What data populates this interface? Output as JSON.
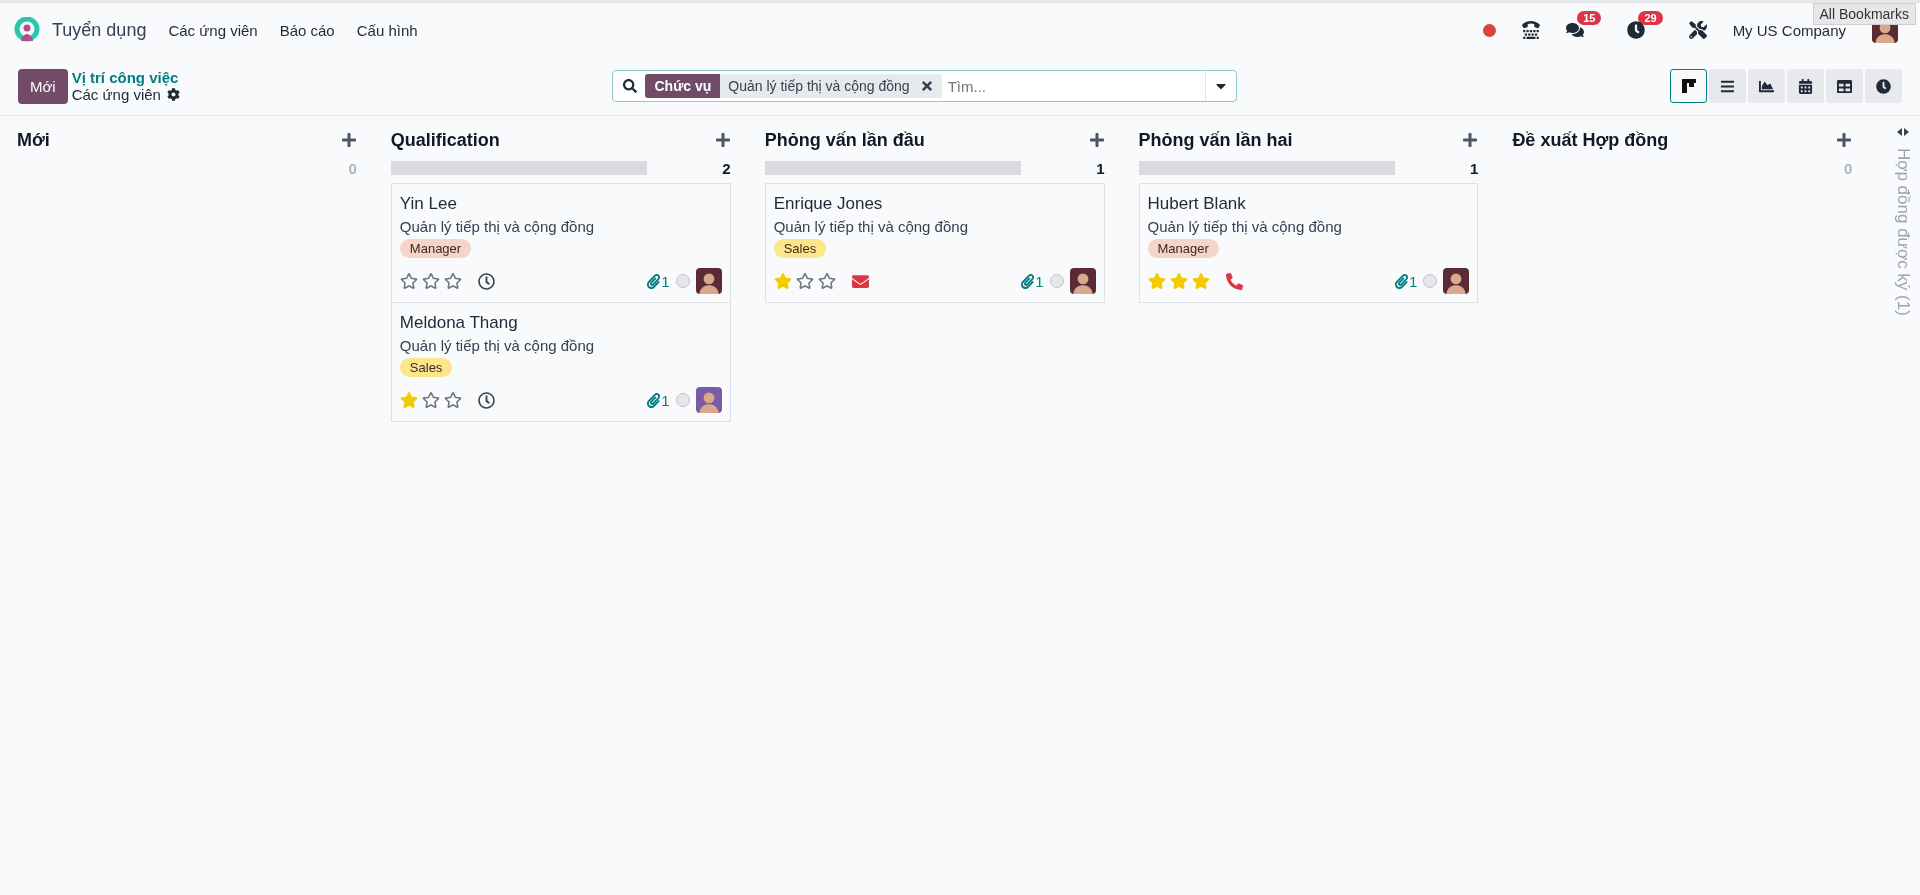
{
  "navbar": {
    "app_name": "Tuyển dụng",
    "menu": [
      "Các ứng viên",
      "Báo cáo",
      "Cấu hình"
    ],
    "systray": [
      {
        "kind": "recording"
      },
      {
        "kind": "phone"
      },
      {
        "kind": "messages",
        "badge": "15"
      },
      {
        "kind": "activities",
        "badge": "29"
      },
      {
        "kind": "tools"
      }
    ],
    "company": "My US Company",
    "tooltip": "All Bookmarks"
  },
  "control_panel": {
    "new_button": "Mới",
    "breadcrumb": "Vị trí công việc",
    "current": "Các ứng viên",
    "search": {
      "facet_label": "Chức vụ",
      "facet_value": "Quản lý tiếp thị và cộng đồng",
      "placeholder": "Tìm..."
    },
    "views": [
      {
        "kind": "kanban",
        "selected": true
      },
      {
        "kind": "list",
        "selected": false
      },
      {
        "kind": "graph",
        "selected": false
      },
      {
        "kind": "calendar",
        "selected": false
      },
      {
        "kind": "pivot",
        "selected": false
      },
      {
        "kind": "activity",
        "selected": false
      }
    ]
  },
  "columns": [
    {
      "title": "Mới",
      "count": "0"
    },
    {
      "title": "Qualification",
      "count": "2",
      "progress": {
        "level": 0
      },
      "cards": [
        {
          "name": "Yin Lee",
          "job": "Quản lý tiếp thị và cộng đồng",
          "tag": {
            "label": "Manager",
            "color": "#f7d4c9"
          },
          "stars": 0,
          "activity": {
            "kind": "clock"
          },
          "attachments": "1"
        },
        {
          "name": "Meldona Thang",
          "job": "Quản lý tiếp thị và cộng đồng",
          "tag": {
            "label": "Sales",
            "color": "#fde68a"
          },
          "stars": 1,
          "activity": {
            "kind": "clock"
          },
          "attachments": "1"
        }
      ]
    },
    {
      "title": "Phỏng vấn lần đầu",
      "count": "1",
      "progress": {
        "level": 0
      },
      "cards": [
        {
          "name": "Enrique Jones",
          "job": "Quản lý tiếp thị và cộng đồng",
          "tag": {
            "label": "Sales",
            "color": "#fde68a"
          },
          "stars": 1,
          "activity": {
            "kind": "email"
          },
          "attachments": "1"
        }
      ]
    },
    {
      "title": "Phỏng vấn lần hai",
      "count": "1",
      "progress": {
        "level": 0
      },
      "cards": [
        {
          "name": "Hubert Blank",
          "job": "Quản lý tiếp thị và cộng đồng",
          "tag": {
            "label": "Manager",
            "color": "#f7d4c9"
          },
          "stars": 3,
          "activity": {
            "kind": "phone"
          },
          "attachments": "1"
        }
      ]
    },
    {
      "title": "Đề xuất Hợp đồng",
      "count": "0"
    }
  ],
  "folded_column": {
    "title": "Hợp đồng được ký (1)"
  }
}
